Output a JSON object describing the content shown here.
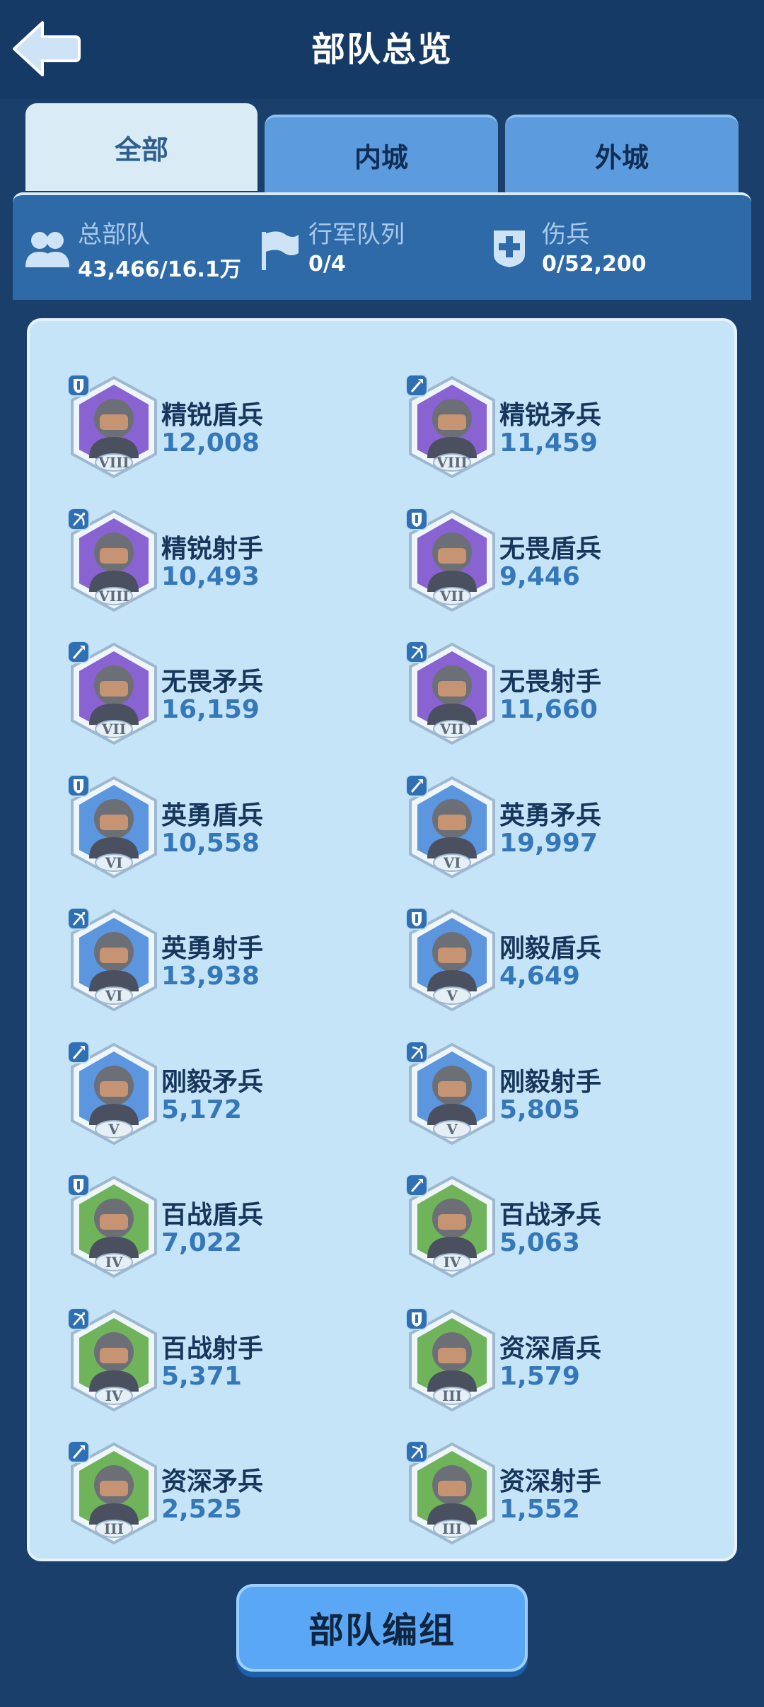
{
  "header": {
    "title": "部队总览"
  },
  "tabs": [
    {
      "label": "全部",
      "active": true
    },
    {
      "label": "内城",
      "active": false
    },
    {
      "label": "外城",
      "active": false
    }
  ],
  "stats": [
    {
      "icon": "people-icon",
      "label": "总部队",
      "value": "43,466/16.1万"
    },
    {
      "icon": "flag-icon",
      "label": "行军队列",
      "value": "0/4"
    },
    {
      "icon": "medical-cross-icon",
      "label": "伤兵",
      "value": "0/52,200"
    }
  ],
  "units": [
    {
      "name": "精锐盾兵",
      "count": "12,008",
      "tier": "VIII",
      "type": "shield"
    },
    {
      "name": "精锐矛兵",
      "count": "11,459",
      "tier": "VIII",
      "type": "spear"
    },
    {
      "name": "精锐射手",
      "count": "10,493",
      "tier": "VIII",
      "type": "archer"
    },
    {
      "name": "无畏盾兵",
      "count": "9,446",
      "tier": "VII",
      "type": "shield"
    },
    {
      "name": "无畏矛兵",
      "count": "16,159",
      "tier": "VII",
      "type": "spear"
    },
    {
      "name": "无畏射手",
      "count": "11,660",
      "tier": "VII",
      "type": "archer"
    },
    {
      "name": "英勇盾兵",
      "count": "10,558",
      "tier": "VI",
      "type": "shield"
    },
    {
      "name": "英勇矛兵",
      "count": "19,997",
      "tier": "VI",
      "type": "spear"
    },
    {
      "name": "英勇射手",
      "count": "13,938",
      "tier": "VI",
      "type": "archer"
    },
    {
      "name": "刚毅盾兵",
      "count": "4,649",
      "tier": "V",
      "type": "shield"
    },
    {
      "name": "刚毅矛兵",
      "count": "5,172",
      "tier": "V",
      "type": "spear"
    },
    {
      "name": "刚毅射手",
      "count": "5,805",
      "tier": "V",
      "type": "archer"
    },
    {
      "name": "百战盾兵",
      "count": "7,022",
      "tier": "IV",
      "type": "shield"
    },
    {
      "name": "百战矛兵",
      "count": "5,063",
      "tier": "IV",
      "type": "spear"
    },
    {
      "name": "百战射手",
      "count": "5,371",
      "tier": "IV",
      "type": "archer"
    },
    {
      "name": "资深盾兵",
      "count": "1,579",
      "tier": "III",
      "type": "shield"
    },
    {
      "name": "资深矛兵",
      "count": "2,525",
      "tier": "III",
      "type": "spear"
    },
    {
      "name": "资深射手",
      "count": "1,552",
      "tier": "III",
      "type": "archer"
    }
  ],
  "footer": {
    "button_label": "部队编组"
  },
  "colors": {
    "tier_VIII": "#8a63d2",
    "tier_VII": "#8a63d2",
    "tier_VI": "#5b96de",
    "tier_V": "#5b96de",
    "tier_IV": "#6fb35a",
    "tier_III": "#6fb35a"
  }
}
